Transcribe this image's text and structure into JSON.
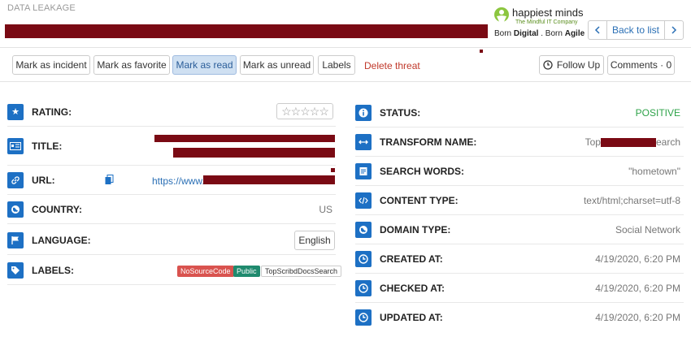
{
  "header": {
    "section_title": "DATA LEAKAGE",
    "logo": {
      "name": "happiest minds",
      "tagline": "The Mindful IT Company",
      "slogan_pre": "Born ",
      "slogan_bold1": "Digital",
      "slogan_mid": " . Born ",
      "slogan_bold2": "Agile"
    },
    "nav": {
      "prev_icon": "chevron-left-icon",
      "back_label": "Back to list",
      "next_icon": "chevron-right-icon"
    }
  },
  "toolbar": {
    "mark_incident": "Mark as incident",
    "mark_favorite": "Mark as favorite",
    "mark_read": "Mark as read",
    "mark_unread": "Mark as unread",
    "labels": "Labels",
    "delete_threat": "Delete threat",
    "follow_up": "Follow Up",
    "comments": "Comments · 0"
  },
  "left_fields": {
    "rating": {
      "label": "RATING:",
      "value": "☆☆☆☆☆",
      "icon": "star-icon"
    },
    "title": {
      "label": "TITLE:",
      "icon": "card-icon"
    },
    "url": {
      "label": "URL:",
      "value_visible": "https://www.s",
      "icon": "link-icon",
      "copy_icon": "copy-icon"
    },
    "country": {
      "label": "COUNTRY:",
      "value": "US",
      "icon": "globe-icon"
    },
    "language": {
      "label": "LANGUAGE:",
      "value": "English",
      "icon": "flag-icon"
    },
    "labels": {
      "label": "LABELS:",
      "icon": "tag-icon",
      "badges": [
        "NoSourceCode",
        "Public",
        "TopScribdDocsSearch"
      ]
    }
  },
  "right_fields": {
    "status": {
      "label": "STATUS:",
      "value": "POSITIVE",
      "icon": "info-icon"
    },
    "transform_name": {
      "label": "TRANSFORM NAME:",
      "value_start": "Top",
      "value_end": "earch",
      "icon": "arrows-horizontal-icon"
    },
    "search_words": {
      "label": "SEARCH WORDS:",
      "value": "\"hometown\"",
      "icon": "search-list-icon"
    },
    "content_type": {
      "label": "CONTENT TYPE:",
      "value": "text/html;charset=utf-8",
      "icon": "code-icon"
    },
    "domain_type": {
      "label": "DOMAIN TYPE:",
      "value": "Social Network",
      "icon": "globe-icon"
    },
    "created_at": {
      "label": "CREATED AT:",
      "value": "4/19/2020, 6:20 PM",
      "icon": "clock-icon"
    },
    "checked_at": {
      "label": "CHECKED AT:",
      "value": "4/19/2020, 6:20 PM",
      "icon": "clock-icon"
    },
    "updated_at": {
      "label": "UPDATED AT:",
      "value": "4/19/2020, 6:20 PM",
      "icon": "clock-icon"
    }
  },
  "colors": {
    "accent": "#1d70c4",
    "redaction": "#7a0a14",
    "positive": "#2fa34a",
    "danger": "#c0392b"
  }
}
